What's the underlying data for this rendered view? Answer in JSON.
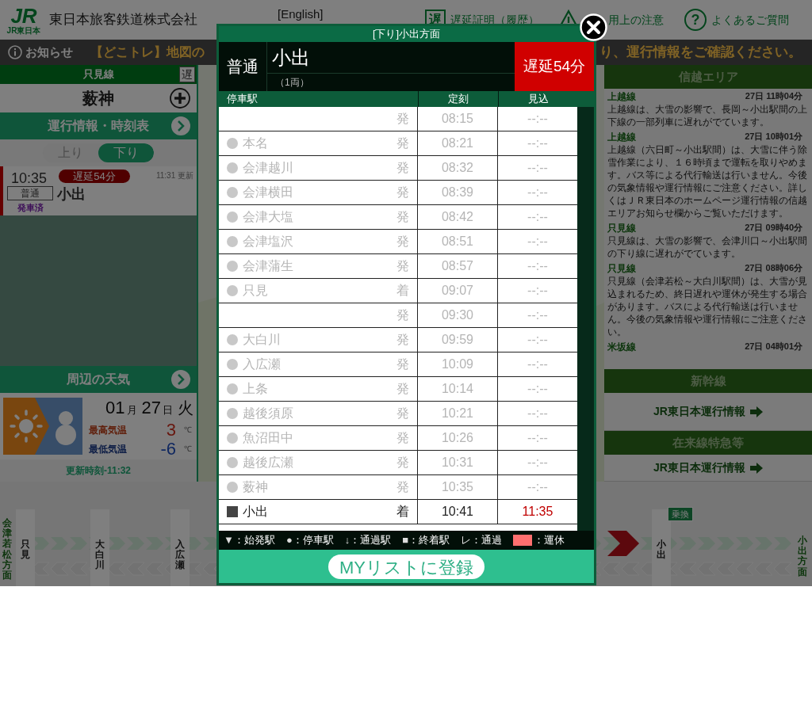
{
  "header": {
    "logo_text": "JR",
    "logo_caption": "JR東日本",
    "company": "東日本旅客鉄道株式会社",
    "english_link": "[English]",
    "links": [
      {
        "kind": "badge",
        "glyph": "遅",
        "label": "遅延証明（履歴）"
      },
      {
        "kind": "warning",
        "label": "用上の注意"
      },
      {
        "kind": "help",
        "glyph": "?",
        "label": "よくあるご質問"
      }
    ]
  },
  "notice": {
    "label": "お知らせ",
    "text_left": "【どこトレ】地図の",
    "text_right": "り、運行情報をご確認ください。"
  },
  "left": {
    "line": "只見線",
    "delay_glyph": "遅",
    "station": "薮神",
    "timetable_link": "運行情報・時刻表",
    "tabs": [
      {
        "label": "上り",
        "selected": false
      },
      {
        "label": "下り",
        "selected": true
      }
    ],
    "train": {
      "time": "10:35",
      "delay": "遅延54分",
      "updated": "11:31 更新",
      "type": "普通",
      "destination": "小出",
      "status": "発車済"
    },
    "weather_link": "周辺の天気",
    "weather": {
      "month": "01",
      "month_unit": "月",
      "day": "27",
      "day_unit": "日",
      "weekday": "火",
      "high_label": "最高気温",
      "high": "3",
      "high_unit": "℃",
      "low_label": "最低気温",
      "low": "-6",
      "low_unit": "℃",
      "updated": "更新時刻-11:32"
    }
  },
  "right": {
    "area": "信越エリア",
    "news": [
      {
        "line": "上越線",
        "time": "27日 11時04分",
        "text": "上越線は、大雪の影響で、長岡～小出駅間の上下線の一部列車に遅れがでています。"
      },
      {
        "line": "上越線",
        "time": "27日 10時01分",
        "text": "上越線（六日町～小出駅間）は、大雪に伴う除雪作業により、１６時頃まで運転を取りやめます。バス等による代行輸送は行いません。今後の気象情報や運行情報にご注意ください。詳しくはＪＲ東日本のホームページ運行情報の信越エリアお知らせ欄からご覧いただけます。"
      },
      {
        "line": "只見線",
        "time": "27日 09時40分",
        "text": "只見線は、大雪の影響で、会津川口～小出駅間の下り線に遅れがでています。"
      },
      {
        "line": "只見線",
        "time": "27日 08時06分",
        "text": "只見線（会津若松～大白川駅間）は、大雪が見込まれるため、終日遅れや運休が発生する場合があります。バスによる代行輸送は行いません。今後の気象情報や運行情報にご注意ください。"
      },
      {
        "line": "米坂線",
        "time": "27日 04時01分"
      }
    ],
    "sections": [
      {
        "title": "新幹線",
        "link": "JR東日本運行情報"
      },
      {
        "title": "在来線特急等",
        "link": "JR東日本運行情報"
      }
    ]
  },
  "diagram": {
    "left_direction": "会津若松方面",
    "right_direction": "小出方面",
    "stations": [
      {
        "name": "只見"
      },
      {
        "name": "大白川"
      },
      {
        "name": "入広瀬"
      },
      {
        "name": "小出",
        "transfer": "乗換"
      }
    ]
  },
  "modal": {
    "title": "[下り]小出方面",
    "train_type": "普通",
    "destination": "小出",
    "cars": "（1両）",
    "delay": "遅延54分",
    "columns": [
      "停車駅",
      "定刻",
      "見込"
    ],
    "rows": [
      {
        "kind": "plain",
        "event": "発",
        "time": "08:15",
        "expected": "--:--",
        "passed": true,
        "delayed": false
      },
      {
        "kind": "stop",
        "station": "本名",
        "event": "発",
        "time": "08:21",
        "expected": "--:--",
        "passed": true,
        "delayed": false
      },
      {
        "kind": "stop",
        "station": "会津越川",
        "event": "発",
        "time": "08:32",
        "expected": "--:--",
        "passed": true,
        "delayed": false
      },
      {
        "kind": "stop",
        "station": "会津横田",
        "event": "発",
        "time": "08:39",
        "expected": "--:--",
        "passed": true,
        "delayed": false
      },
      {
        "kind": "stop",
        "station": "会津大塩",
        "event": "発",
        "time": "08:42",
        "expected": "--:--",
        "passed": true,
        "delayed": false
      },
      {
        "kind": "stop",
        "station": "会津塩沢",
        "event": "発",
        "time": "08:51",
        "expected": "--:--",
        "passed": true,
        "delayed": false
      },
      {
        "kind": "stop",
        "station": "会津蒲生",
        "event": "発",
        "time": "08:57",
        "expected": "--:--",
        "passed": true,
        "delayed": false
      },
      {
        "kind": "stop",
        "station": "只見",
        "event": "着",
        "time": "09:07",
        "expected": "--:--",
        "passed": true,
        "delayed": false
      },
      {
        "kind": "plain",
        "event": "発",
        "time": "09:30",
        "expected": "--:--",
        "passed": true,
        "delayed": false
      },
      {
        "kind": "stop",
        "station": "大白川",
        "event": "発",
        "time": "09:59",
        "expected": "--:--",
        "passed": true,
        "delayed": false
      },
      {
        "kind": "stop",
        "station": "入広瀬",
        "event": "発",
        "time": "10:09",
        "expected": "--:--",
        "passed": true,
        "delayed": false
      },
      {
        "kind": "stop",
        "station": "上条",
        "event": "発",
        "time": "10:14",
        "expected": "--:--",
        "passed": true,
        "delayed": false
      },
      {
        "kind": "stop",
        "station": "越後須原",
        "event": "発",
        "time": "10:21",
        "expected": "--:--",
        "passed": true,
        "delayed": false
      },
      {
        "kind": "stop",
        "station": "魚沼田中",
        "event": "発",
        "time": "10:26",
        "expected": "--:--",
        "passed": true,
        "delayed": false
      },
      {
        "kind": "stop",
        "station": "越後広瀬",
        "event": "発",
        "time": "10:31",
        "expected": "--:--",
        "passed": true,
        "delayed": false
      },
      {
        "kind": "stop",
        "station": "薮神",
        "event": "発",
        "time": "10:35",
        "expected": "--:--",
        "passed": true,
        "delayed": false
      },
      {
        "kind": "terminal",
        "station": "小出",
        "event": "着",
        "time": "10:41",
        "expected": "11:35",
        "passed": false,
        "delayed": true
      }
    ],
    "legend": [
      {
        "kind": "glyph",
        "symbol": "▼",
        "label": "：始発駅"
      },
      {
        "kind": "glyph",
        "symbol": "●",
        "label": "：停車駅"
      },
      {
        "kind": "glyph",
        "symbol": "↓",
        "label": "：通過駅"
      },
      {
        "kind": "glyph",
        "symbol": "■",
        "label": "：終着駅"
      },
      {
        "kind": "glyph",
        "symbol": "レ",
        "label": "：通過"
      },
      {
        "kind": "swatch",
        "color": "#ff6f6f",
        "label": "：運休"
      }
    ],
    "register_button": "MYリストに登録"
  }
}
